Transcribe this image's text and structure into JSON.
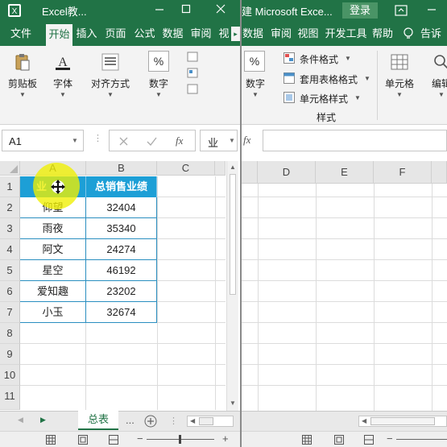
{
  "left_window": {
    "title": "Excel教...",
    "tabs": [
      "文件",
      "开始",
      "插入",
      "页面",
      "公式",
      "数据",
      "审阅",
      "视"
    ],
    "active_tab": "开始",
    "ribbon_groups": [
      "剪贴板",
      "字体",
      "对齐方式",
      "数字"
    ],
    "name_box": "A1",
    "formula_partial": "业",
    "columns": [
      "A",
      "B",
      "C"
    ],
    "rows": [
      "1",
      "2",
      "3",
      "4",
      "5",
      "6",
      "7",
      "8",
      "9",
      "10",
      "11"
    ],
    "table": {
      "headers": [
        "业务员",
        "总销售业绩"
      ],
      "header_visible": [
        "业",
        "总销售业绩"
      ],
      "rows": [
        [
          "仰望",
          "32404"
        ],
        [
          "雨夜",
          "35340"
        ],
        [
          "阿文",
          "24274"
        ],
        [
          "星空",
          "46192"
        ],
        [
          "爱知趣",
          "23202"
        ],
        [
          "小玉",
          "32674"
        ]
      ]
    },
    "sheet_tab": "总表",
    "sheet_more": "..."
  },
  "right_window": {
    "title": "建  Microsoft Exce...",
    "login_label": "登录",
    "tabs": [
      "数据",
      "审阅",
      "视图",
      "开发工具",
      "帮助",
      "告诉"
    ],
    "number_group_label": "数字",
    "styles": {
      "items": [
        "条件格式",
        "套用表格格式",
        "单元格样式"
      ],
      "group_label": "样式"
    },
    "cells_label": "单元格",
    "edit_label": "编辑",
    "columns": [
      "D",
      "E",
      "F"
    ]
  },
  "colors": {
    "excel_green": "#217346",
    "header_fill": "#1d9fd6",
    "cursor_highlight": "#f0f000"
  },
  "icons": [
    "minimize-icon",
    "restore-icon",
    "close-icon",
    "paste-icon",
    "font-icon",
    "align-icon",
    "percent-icon",
    "cancel-icon",
    "enter-icon",
    "fx-icon",
    "add-sheet-icon",
    "lightbulb-icon",
    "search-icon"
  ]
}
